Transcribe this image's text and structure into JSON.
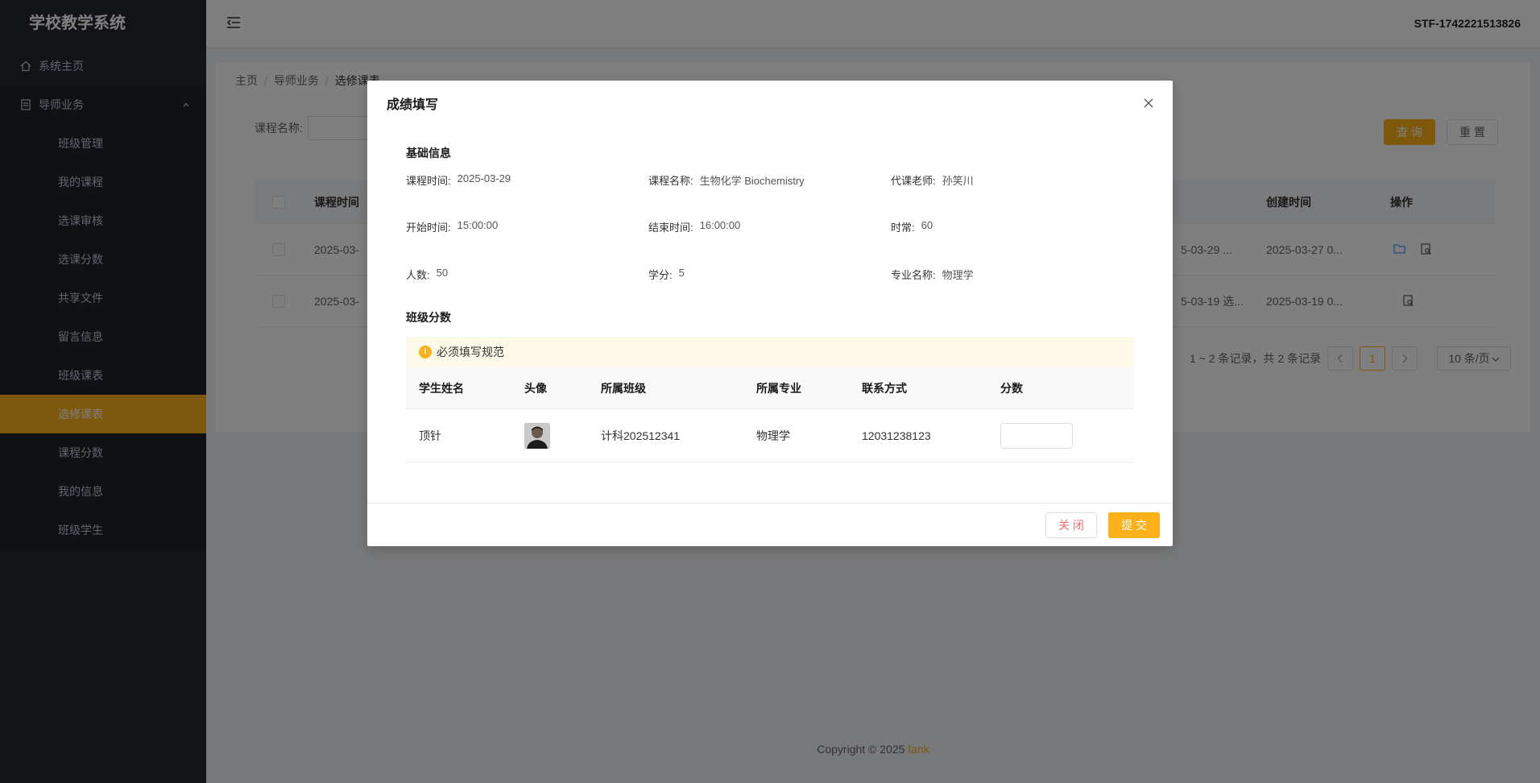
{
  "app": {
    "title": "学校教学系统"
  },
  "sidebar": {
    "home": {
      "label": "系统主页",
      "icon": "home-icon"
    },
    "group": {
      "label": "导师业务",
      "icon": "document-icon",
      "expanded": true
    },
    "items": [
      {
        "label": "班级管理"
      },
      {
        "label": "我的课程"
      },
      {
        "label": "选课审核"
      },
      {
        "label": "选课分数"
      },
      {
        "label": "共享文件"
      },
      {
        "label": "留言信息"
      },
      {
        "label": "班级课表"
      },
      {
        "label": "选修课表",
        "active": true
      },
      {
        "label": "课程分数"
      },
      {
        "label": "我的信息"
      },
      {
        "label": "班级学生"
      }
    ]
  },
  "header": {
    "user": "STF-1742221513826"
  },
  "breadcrumb": {
    "home": "主页",
    "level1": "导师业务",
    "current": "选修课表"
  },
  "search": {
    "label": "课程名称:",
    "query": "查 询",
    "reset": "重 置"
  },
  "table": {
    "headers": {
      "course_time": "课程时间",
      "created": "创建时间",
      "action": "操作"
    },
    "rows": [
      {
        "time": "2025-03-",
        "mid": "5-03-29 ...",
        "created": "2025-03-27 0..."
      },
      {
        "time": "2025-03-",
        "mid": "5-03-19 选...",
        "created": "2025-03-19 0..."
      }
    ]
  },
  "pager": {
    "summary": "1 ~ 2 条记录，共 2 条记录",
    "page": "1",
    "size": "10 条/页"
  },
  "footer": {
    "copyright": "Copyright © 2025 ",
    "brand": "fank"
  },
  "dialog": {
    "title": "成绩填写",
    "basic_title": "基础信息",
    "info": {
      "course_time_k": "课程时间:",
      "course_time_v": "2025-03-29",
      "course_name_k": "课程名称:",
      "course_name_v": "生物化学 Biochemistry",
      "teacher_k": "代课老师:",
      "teacher_v": "孙笑川",
      "start_k": "开始时间:",
      "start_v": "15:00:00",
      "end_k": "结束时间:",
      "end_v": "16:00:00",
      "duration_k": "时常:",
      "duration_v": "60",
      "count_k": "人数:",
      "count_v": "50",
      "credit_k": "学分:",
      "credit_v": "5",
      "major_k": "专业名称:",
      "major_v": "物理学"
    },
    "class_title": "班级分数",
    "notice": "必须填写规范",
    "score_table": {
      "headers": {
        "name": "学生姓名",
        "avatar": "头像",
        "class": "所属班级",
        "major": "所属专业",
        "contact": "联系方式",
        "score": "分数"
      },
      "rows": [
        {
          "name": "顶针",
          "class": "计科202512341",
          "major": "物理学",
          "contact": "12031238123",
          "score": ""
        }
      ]
    },
    "close_label": "关 闭",
    "submit_label": "提 交"
  },
  "colors": {
    "accent": "#fcb11a",
    "sidebar_bg": "#22262e",
    "danger": "#f56c6c"
  }
}
